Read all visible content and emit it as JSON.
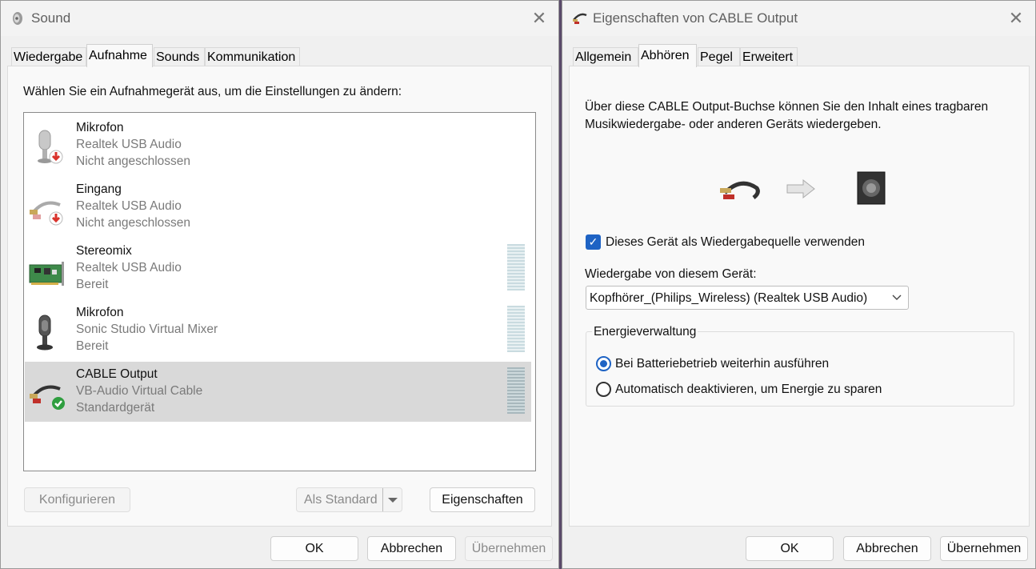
{
  "sound_window": {
    "title": "Sound",
    "tabs": [
      "Wiedergabe",
      "Aufnahme",
      "Sounds",
      "Kommunikation"
    ],
    "active_tab": "Aufnahme",
    "instruction": "Wählen Sie ein Aufnahmegerät aus, um die Einstellungen zu ändern:",
    "devices": [
      {
        "name": "Mikrofon",
        "driver": "Realtek USB Audio",
        "status": "Nicht angeschlossen",
        "icon": "microphone-icon"
      },
      {
        "name": "Eingang",
        "driver": "Realtek USB Audio",
        "status": "Nicht angeschlossen",
        "icon": "cable-jack-icon"
      },
      {
        "name": "Stereomix",
        "driver": "Realtek USB Audio",
        "status": "Bereit",
        "icon": "sound-card-icon"
      },
      {
        "name": "Mikrofon",
        "driver": "Sonic Studio Virtual Mixer",
        "status": "Bereit",
        "icon": "microphone-icon"
      },
      {
        "name": "CABLE Output",
        "driver": "VB-Audio Virtual Cable",
        "status": "Standardgerät",
        "icon": "cable-jack-icon"
      }
    ],
    "selected_device": "CABLE Output",
    "buttons": {
      "configure": "Konfigurieren",
      "set_default": "Als Standard",
      "properties": "Eigenschaften"
    },
    "footer": {
      "ok": "OK",
      "cancel": "Abbrechen",
      "apply": "Übernehmen"
    }
  },
  "props_window": {
    "title": "Eigenschaften von CABLE Output",
    "tabs": [
      "Allgemein",
      "Abhören",
      "Pegel",
      "Erweitert"
    ],
    "active_tab": "Abhören",
    "description": "Über diese CABLE Output-Buchse können Sie den Inhalt eines tragbaren Musikwiedergabe- oder anderen Geräts wiedergeben.",
    "listen_checkbox": {
      "label": "Dieses Gerät als Wiedergabequelle verwenden",
      "checked": true
    },
    "playback_label": "Wiedergabe von diesem Gerät:",
    "playback_device": "Kopfhörer_(Philips_Wireless) (Realtek USB Audio)",
    "power_group": "Energieverwaltung",
    "power_options": [
      {
        "label": "Bei Batteriebetrieb weiterhin ausführen",
        "selected": true
      },
      {
        "label": "Automatisch deaktivieren, um Energie zu sparen",
        "selected": false
      }
    ],
    "footer": {
      "ok": "OK",
      "cancel": "Abbrechen",
      "apply": "Übernehmen"
    }
  },
  "colors": {
    "accent": "#1e63c4",
    "selection": "#d9d9d9",
    "error_badge": "#d9322b",
    "ok_badge": "#2f9e3f"
  }
}
